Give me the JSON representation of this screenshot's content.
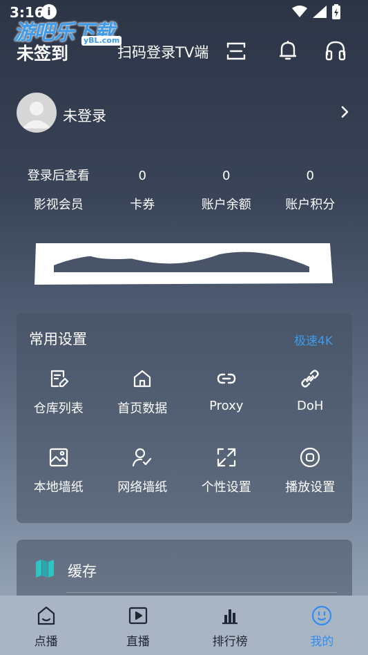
{
  "status_bar": {
    "time": "3:16"
  },
  "watermark": {
    "text": "游吧乐下载",
    "sub": "yBL.com"
  },
  "header": {
    "title": "未签到",
    "scan_label": "扫码登录TV端"
  },
  "profile": {
    "name": "未登录"
  },
  "stats": [
    {
      "value": "登录后查看",
      "label": "影视会员"
    },
    {
      "value": "0",
      "label": "卡券"
    },
    {
      "value": "0",
      "label": "账户余额"
    },
    {
      "value": "0",
      "label": "账户积分"
    }
  ],
  "settings": {
    "title": "常用设置",
    "badge": "极速4K",
    "items": [
      {
        "label": "仓库列表",
        "icon": "edit-icon"
      },
      {
        "label": "首页数据",
        "icon": "home-icon"
      },
      {
        "label": "Proxy",
        "icon": "link-icon"
      },
      {
        "label": "DoH",
        "icon": "chain-icon"
      },
      {
        "label": "本地墙纸",
        "icon": "image-icon"
      },
      {
        "label": "网络墙纸",
        "icon": "user-check-icon"
      },
      {
        "label": "个性设置",
        "icon": "expand-icon"
      },
      {
        "label": "播放设置",
        "icon": "stop-circle-icon"
      }
    ]
  },
  "cache": {
    "label": "缓存"
  },
  "tabbar": {
    "tabs": [
      {
        "label": "点播",
        "icon": "home-tab-icon"
      },
      {
        "label": "直播",
        "icon": "play-icon"
      },
      {
        "label": "排行榜",
        "icon": "bar-chart-icon"
      },
      {
        "label": "我的",
        "icon": "smile-icon",
        "active": true
      }
    ]
  },
  "colors": {
    "accent": "#2f8ff0",
    "badge": "#3d9be9",
    "cache_icon": "#2ec4c4"
  }
}
